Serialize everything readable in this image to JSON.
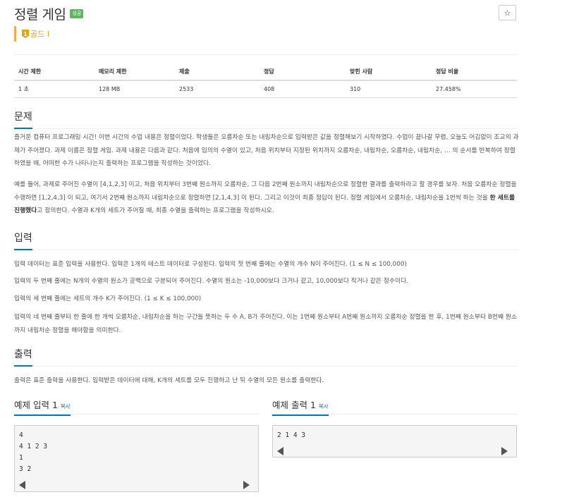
{
  "problem": {
    "title": "정렬 게임",
    "status_badge": "성공",
    "star_icon": "☆",
    "tier": {
      "icon_text": "1",
      "label": "골드 I",
      "color": "#e8a500"
    }
  },
  "stats": {
    "headers": [
      "시간 제한",
      "메모리 제한",
      "제출",
      "정답",
      "맞힌 사람",
      "정답 비율"
    ],
    "values": [
      "1 초",
      "128 MB",
      "2533",
      "408",
      "310",
      "27.458%"
    ]
  },
  "sections": {
    "description": {
      "title": "문제",
      "p1": "즐거운 컴퓨터 프로그래밍 시간! 이번 시간의 수업 내용은 정렬이었다. 학생들은 오름차순 또는 내림차순으로 입력받은 값을 정렬해보기 시작하였다. 수업이 끝나갈 무렵, 오늘도 어김없이 조교의 과제가 주어졌다. 과제 이름은 정렬 게임. 과제 내용은 다음과 같다. 처음에 임의의 수열이 있고, 처음 위치부터 지정된 위치까지 오름차순, 내림차순, 오름차순, 내림차순, … 의 순서를 반복하여 정렬하였을 때, 어떠한 수가 나타나는지 출력하는 프로그램을 작성하는 것이었다.",
      "p2_before": "예를 들어, 과제로 주어진 수열이 [4,1,2,3] 이고, 처음 위치부터 3번째 원소까지 오름차순, 그 다음 2번째 원소까지 내림차순으로 정렬한 결과를 출력하라고 할 경우를 보자. 처음 오름차순 정렬을 수행하면 [1,2,4,3] 이 되고, 여기서 2번째 원소까지 내림차순으로 정렬하면 [2,1,4,3] 이 된다. 그리고 이것이 최종 정답이 된다. 정렬 게임에서 오름차순, 내림차순을 1번씩 하는 것을 ",
      "p2_bold": "한 세트를 진행했다",
      "p2_after": "고 정의한다. 수열과 K개의 세트가 주어질 때, 최종 수열을 출력하는 프로그램을 작성하시오."
    },
    "input": {
      "title": "입력",
      "p1": "입력 데이터는 표준 입력을 사용한다. 입력은 1개의 테스트 데이터로 구성된다. 입력의 첫 번째 줄에는 수열의 개수 N이 주어진다. (1 ≤ N ≤ 100,000)",
      "p2": "입력의 두 번째 줄에는 N개의 수열의 원소가 공백으로 구분되어 주어진다. 수열의 원소는 -10,000보다 크거나 같고, 10,000보다 작거나 같은 정수이다.",
      "p3": "입력의 세 번째 줄에는 세트의 개수 K가 주어진다. (1 ≤ K ≤ 100,000)",
      "p4": "입력의 네 번째 줄부터 한 줄에 한 개씩 오름차순, 내림차순을 하는 구간을 뜻하는 두 수 A, B가 주어진다. 이는 1번째 원소부터 A번째 원소까지 오름차순 정렬을 한 후, 1번째 원소부터 B번째 원소까지 내림차순 정렬을 해야함을 의미한다."
    },
    "output": {
      "title": "출력",
      "p1": "출력은 표준 출력을 사용한다. 입력받은 데이터에 대해, K개의 세트를 모두 진행하고 난 뒤 수열의 모든 원소를 출력한다."
    }
  },
  "samples": {
    "input": {
      "title": "예제 입력 1",
      "copy_label": "복사",
      "content": "4\n4 1 2 3\n1\n3 2"
    },
    "output": {
      "title": "예제 출력 1",
      "copy_label": "복사",
      "content": "2 1 4 3"
    }
  }
}
